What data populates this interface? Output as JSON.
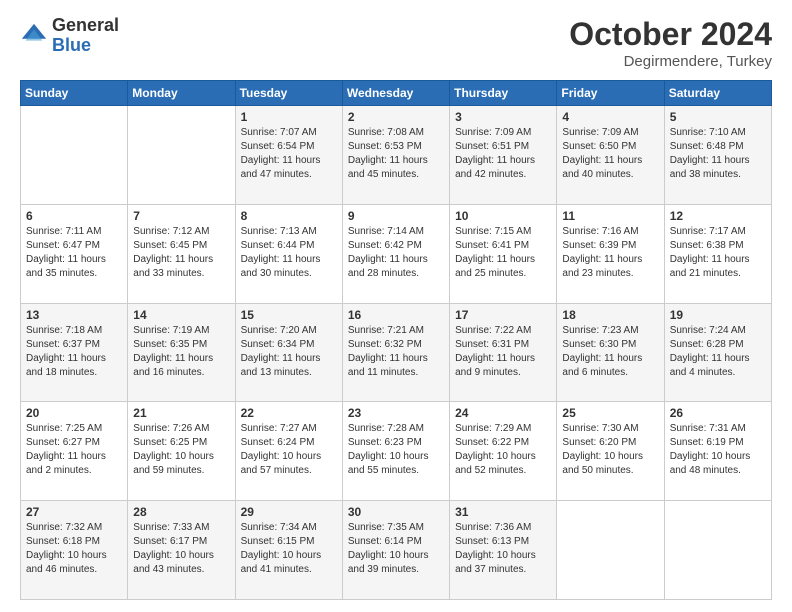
{
  "logo": {
    "general": "General",
    "blue": "Blue"
  },
  "header": {
    "month": "October 2024",
    "location": "Degirmendere, Turkey"
  },
  "weekdays": [
    "Sunday",
    "Monday",
    "Tuesday",
    "Wednesday",
    "Thursday",
    "Friday",
    "Saturday"
  ],
  "weeks": [
    [
      {
        "day": "",
        "content": ""
      },
      {
        "day": "",
        "content": ""
      },
      {
        "day": "1",
        "content": "Sunrise: 7:07 AM\nSunset: 6:54 PM\nDaylight: 11 hours and 47 minutes."
      },
      {
        "day": "2",
        "content": "Sunrise: 7:08 AM\nSunset: 6:53 PM\nDaylight: 11 hours and 45 minutes."
      },
      {
        "day": "3",
        "content": "Sunrise: 7:09 AM\nSunset: 6:51 PM\nDaylight: 11 hours and 42 minutes."
      },
      {
        "day": "4",
        "content": "Sunrise: 7:09 AM\nSunset: 6:50 PM\nDaylight: 11 hours and 40 minutes."
      },
      {
        "day": "5",
        "content": "Sunrise: 7:10 AM\nSunset: 6:48 PM\nDaylight: 11 hours and 38 minutes."
      }
    ],
    [
      {
        "day": "6",
        "content": "Sunrise: 7:11 AM\nSunset: 6:47 PM\nDaylight: 11 hours and 35 minutes."
      },
      {
        "day": "7",
        "content": "Sunrise: 7:12 AM\nSunset: 6:45 PM\nDaylight: 11 hours and 33 minutes."
      },
      {
        "day": "8",
        "content": "Sunrise: 7:13 AM\nSunset: 6:44 PM\nDaylight: 11 hours and 30 minutes."
      },
      {
        "day": "9",
        "content": "Sunrise: 7:14 AM\nSunset: 6:42 PM\nDaylight: 11 hours and 28 minutes."
      },
      {
        "day": "10",
        "content": "Sunrise: 7:15 AM\nSunset: 6:41 PM\nDaylight: 11 hours and 25 minutes."
      },
      {
        "day": "11",
        "content": "Sunrise: 7:16 AM\nSunset: 6:39 PM\nDaylight: 11 hours and 23 minutes."
      },
      {
        "day": "12",
        "content": "Sunrise: 7:17 AM\nSunset: 6:38 PM\nDaylight: 11 hours and 21 minutes."
      }
    ],
    [
      {
        "day": "13",
        "content": "Sunrise: 7:18 AM\nSunset: 6:37 PM\nDaylight: 11 hours and 18 minutes."
      },
      {
        "day": "14",
        "content": "Sunrise: 7:19 AM\nSunset: 6:35 PM\nDaylight: 11 hours and 16 minutes."
      },
      {
        "day": "15",
        "content": "Sunrise: 7:20 AM\nSunset: 6:34 PM\nDaylight: 11 hours and 13 minutes."
      },
      {
        "day": "16",
        "content": "Sunrise: 7:21 AM\nSunset: 6:32 PM\nDaylight: 11 hours and 11 minutes."
      },
      {
        "day": "17",
        "content": "Sunrise: 7:22 AM\nSunset: 6:31 PM\nDaylight: 11 hours and 9 minutes."
      },
      {
        "day": "18",
        "content": "Sunrise: 7:23 AM\nSunset: 6:30 PM\nDaylight: 11 hours and 6 minutes."
      },
      {
        "day": "19",
        "content": "Sunrise: 7:24 AM\nSunset: 6:28 PM\nDaylight: 11 hours and 4 minutes."
      }
    ],
    [
      {
        "day": "20",
        "content": "Sunrise: 7:25 AM\nSunset: 6:27 PM\nDaylight: 11 hours and 2 minutes."
      },
      {
        "day": "21",
        "content": "Sunrise: 7:26 AM\nSunset: 6:25 PM\nDaylight: 10 hours and 59 minutes."
      },
      {
        "day": "22",
        "content": "Sunrise: 7:27 AM\nSunset: 6:24 PM\nDaylight: 10 hours and 57 minutes."
      },
      {
        "day": "23",
        "content": "Sunrise: 7:28 AM\nSunset: 6:23 PM\nDaylight: 10 hours and 55 minutes."
      },
      {
        "day": "24",
        "content": "Sunrise: 7:29 AM\nSunset: 6:22 PM\nDaylight: 10 hours and 52 minutes."
      },
      {
        "day": "25",
        "content": "Sunrise: 7:30 AM\nSunset: 6:20 PM\nDaylight: 10 hours and 50 minutes."
      },
      {
        "day": "26",
        "content": "Sunrise: 7:31 AM\nSunset: 6:19 PM\nDaylight: 10 hours and 48 minutes."
      }
    ],
    [
      {
        "day": "27",
        "content": "Sunrise: 7:32 AM\nSunset: 6:18 PM\nDaylight: 10 hours and 46 minutes."
      },
      {
        "day": "28",
        "content": "Sunrise: 7:33 AM\nSunset: 6:17 PM\nDaylight: 10 hours and 43 minutes."
      },
      {
        "day": "29",
        "content": "Sunrise: 7:34 AM\nSunset: 6:15 PM\nDaylight: 10 hours and 41 minutes."
      },
      {
        "day": "30",
        "content": "Sunrise: 7:35 AM\nSunset: 6:14 PM\nDaylight: 10 hours and 39 minutes."
      },
      {
        "day": "31",
        "content": "Sunrise: 7:36 AM\nSunset: 6:13 PM\nDaylight: 10 hours and 37 minutes."
      },
      {
        "day": "",
        "content": ""
      },
      {
        "day": "",
        "content": ""
      }
    ]
  ]
}
